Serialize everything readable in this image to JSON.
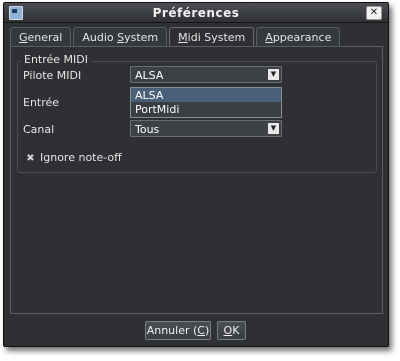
{
  "window": {
    "title": "Préférences"
  },
  "tabs": [
    {
      "pre": "",
      "key": "G",
      "post": "eneral"
    },
    {
      "pre": "Audio ",
      "key": "S",
      "post": "ystem"
    },
    {
      "pre": "",
      "key": "M",
      "post": "idi System"
    },
    {
      "pre": "",
      "key": "A",
      "post": "ppearance"
    }
  ],
  "midi": {
    "group_title": "Entrée MIDI",
    "driver_label": "Pilote MIDI",
    "driver_value": "ALSA",
    "driver_options": [
      "ALSA",
      "PortMidi"
    ],
    "input_label": "Entrée",
    "channel_label": "Canal",
    "channel_value": "Tous",
    "ignore_noteoff_label": "Ignore note-off",
    "ignore_noteoff_checked": true
  },
  "buttons": {
    "cancel_pre": "Annuler (",
    "cancel_key": "C",
    "cancel_post": ")",
    "ok_key": "O",
    "ok_post": "K"
  }
}
